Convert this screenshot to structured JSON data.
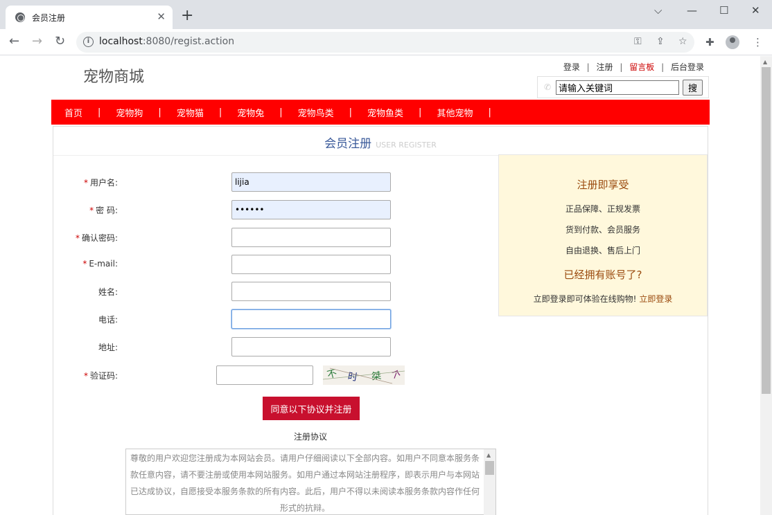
{
  "browser": {
    "tab_title": "会员注册",
    "tab_close": "✕",
    "new_tab": "+",
    "url_host": "localhost",
    "url_rest": ":8080/regist.action",
    "win_min": "⌵",
    "win_restore": "—",
    "win_max": "☐",
    "win_close": "✕"
  },
  "site": {
    "logo": "宠物商城",
    "toplinks": {
      "login": "登录",
      "register": "注册",
      "board": "留言板",
      "admin": "后台登录",
      "sep": "|"
    },
    "search": {
      "placeholder": "请输入关键词",
      "button": "搜"
    },
    "nav": [
      "首页",
      "宠物狗",
      "宠物猫",
      "宠物兔",
      "宠物鸟类",
      "宠物鱼类",
      "其他宠物"
    ],
    "nav_sep": "|"
  },
  "register": {
    "title_cn": "会员注册",
    "title_en": "USER REGISTER",
    "fields": [
      {
        "label": "用户名:",
        "required": true,
        "value": "lijia"
      },
      {
        "label": "密  码:",
        "required": true,
        "value": "••••••"
      },
      {
        "label": "确认密码:",
        "required": true,
        "value": ""
      },
      {
        "label": "E-mail:",
        "required": true,
        "value": ""
      },
      {
        "label": "姓名:",
        "required": false,
        "value": ""
      },
      {
        "label": "电话:",
        "required": false,
        "value": ""
      },
      {
        "label": "地址:",
        "required": false,
        "value": ""
      }
    ],
    "captcha_label": "验证码:",
    "captcha_value": "",
    "captcha_chars": [
      "不",
      "时",
      "桀",
      "个"
    ],
    "star": "*",
    "submit": "同意以下协议并注册",
    "agreement_title": "注册协议",
    "agreement_text": "尊敬的用户欢迎您注册成为本网站会员。请用户仔细阅读以下全部内容。如用户不同意本服务条款任意内容，请不要注册或使用本网站服务。如用户通过本网站注册程序，即表示用户与本网站已达成协议，自愿接受本服务条款的所有内容。此后，用户不得以未阅读本服务条款内容作任何形式的抗辩。"
  },
  "sidebar": {
    "heading1": "注册即享受",
    "items": [
      "正品保障、正规发票",
      "货到付款、会员服务",
      "自由退换、售后上门"
    ],
    "heading2": "已经拥有账号了?",
    "login_text": "立即登录即可体验在线购物!",
    "login_link": "立即登录"
  }
}
